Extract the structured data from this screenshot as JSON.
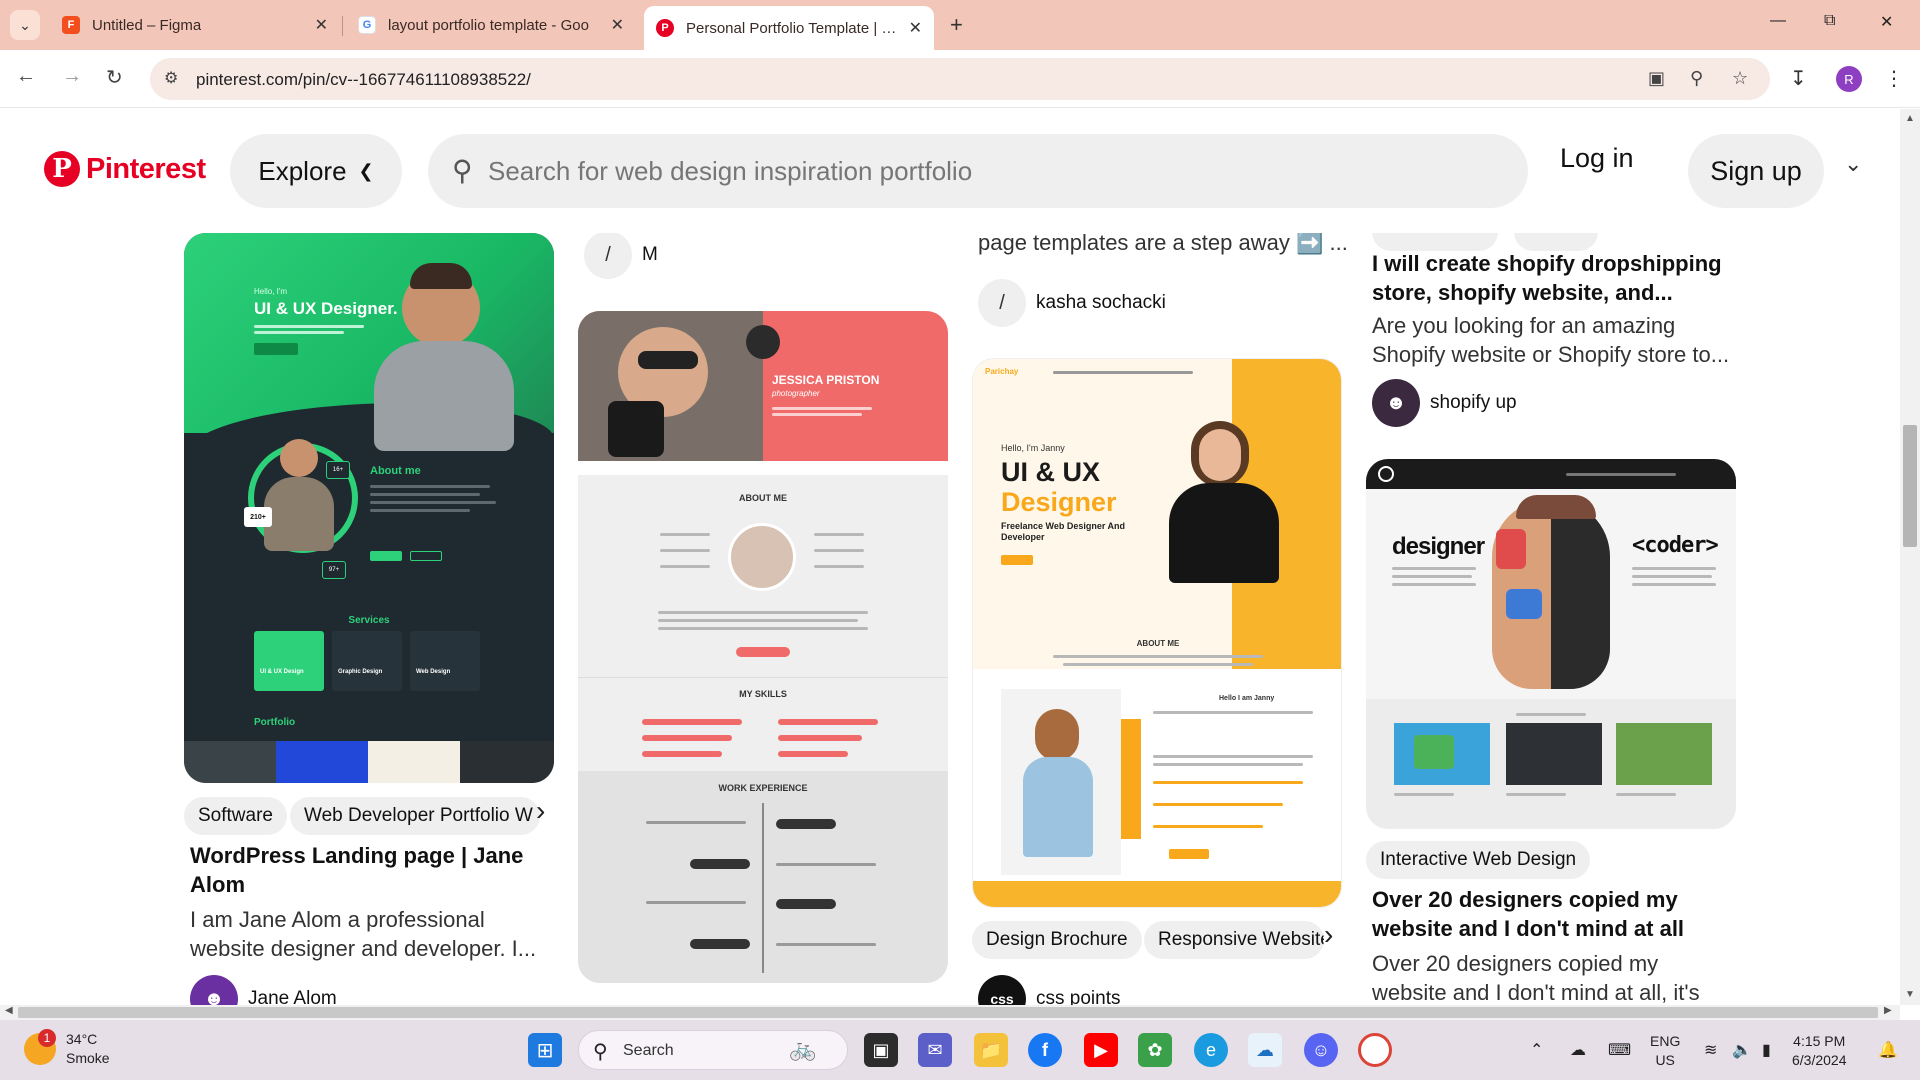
{
  "browser": {
    "tabs": [
      {
        "title": "Untitled – Figma",
        "favicon": "figma-icon",
        "active": false
      },
      {
        "title": "layout portfolio template - Goo",
        "favicon": "google-icon",
        "active": false
      },
      {
        "title": "Personal Portfolio Template | Po",
        "favicon": "pinterest-icon",
        "active": true
      }
    ],
    "url": "pinterest.com/pin/cv--166774611108938522/"
  },
  "header": {
    "logo_text": "Pinterest",
    "logo_letter": "P",
    "explore_label": "Explore",
    "search_placeholder": "Search for web design inspiration portfolio",
    "login_label": "Log in",
    "signup_label": "Sign up",
    "profile_initial": "R"
  },
  "columns": {
    "col1": {
      "mockup": {
        "headline_small": "Hello, I'm",
        "headline": "UI & UX Designer.",
        "about_heading": "About me",
        "services_heading": "Services",
        "services": [
          "UI & UX Design",
          "Graphic Design",
          "Web Design"
        ],
        "portfolio_heading": "Portfolio",
        "stat1": "210+",
        "stat2": "16+",
        "stat3": "97+"
      },
      "chips": [
        "Software",
        "Web Developer Portfolio W"
      ],
      "title": "WordPress Landing page | Jane Alom",
      "description": "I am Jane Alom a professional website designer and developer. I...",
      "author": "Jane Alom"
    },
    "col2": {
      "top_author_initial": "/",
      "top_author": "M",
      "mockup": {
        "name": "JESSICA PRISTON",
        "role": "photographer",
        "about_heading": "ABOUT ME",
        "skills_heading": "MY SKILLS",
        "experience_heading": "WORK EXPERIENCE"
      }
    },
    "col3": {
      "desc_tail": "page templates are a step away ➡️ ...",
      "top_author_initial": "/",
      "top_author": "kasha sochacki",
      "mockup": {
        "brand": "Parichay",
        "hello": "Hello, I'm Janny",
        "headline_1": "UI & UX",
        "headline_2": "Designer",
        "sub": "Freelance Web Designer And Developer",
        "about_heading": "ABOUT ME",
        "hello_2": "Hello I am Janny"
      },
      "chips": [
        "Design Brochure",
        "Responsive Website"
      ],
      "author": "css points",
      "author_initials": "css"
    },
    "col4": {
      "title_top": "I will create shopify dropshipping store, shopify website, and...",
      "description_top": "Are you looking for an amazing Shopify website or Shopify store to...",
      "author_top": "shopify up",
      "mockup": {
        "left_word": "designer",
        "right_word": "<coder>"
      },
      "chips": [
        "Interactive Web Design"
      ],
      "title": "Over 20 designers copied my website and I don't mind at all",
      "description": "Over 20 designers copied my website and I don't mind at all, it's"
    }
  },
  "taskbar": {
    "temperature": "34°C",
    "condition": "Smoke",
    "weather_badge": "1",
    "search_label": "Search",
    "lang_top": "ENG",
    "lang_bottom": "US",
    "time": "4:15 PM",
    "date": "6/3/2024"
  },
  "colors": {
    "pinterest_red": "#e60023",
    "tabbar": "#f2c6b8",
    "chip_bg": "#efefef"
  }
}
